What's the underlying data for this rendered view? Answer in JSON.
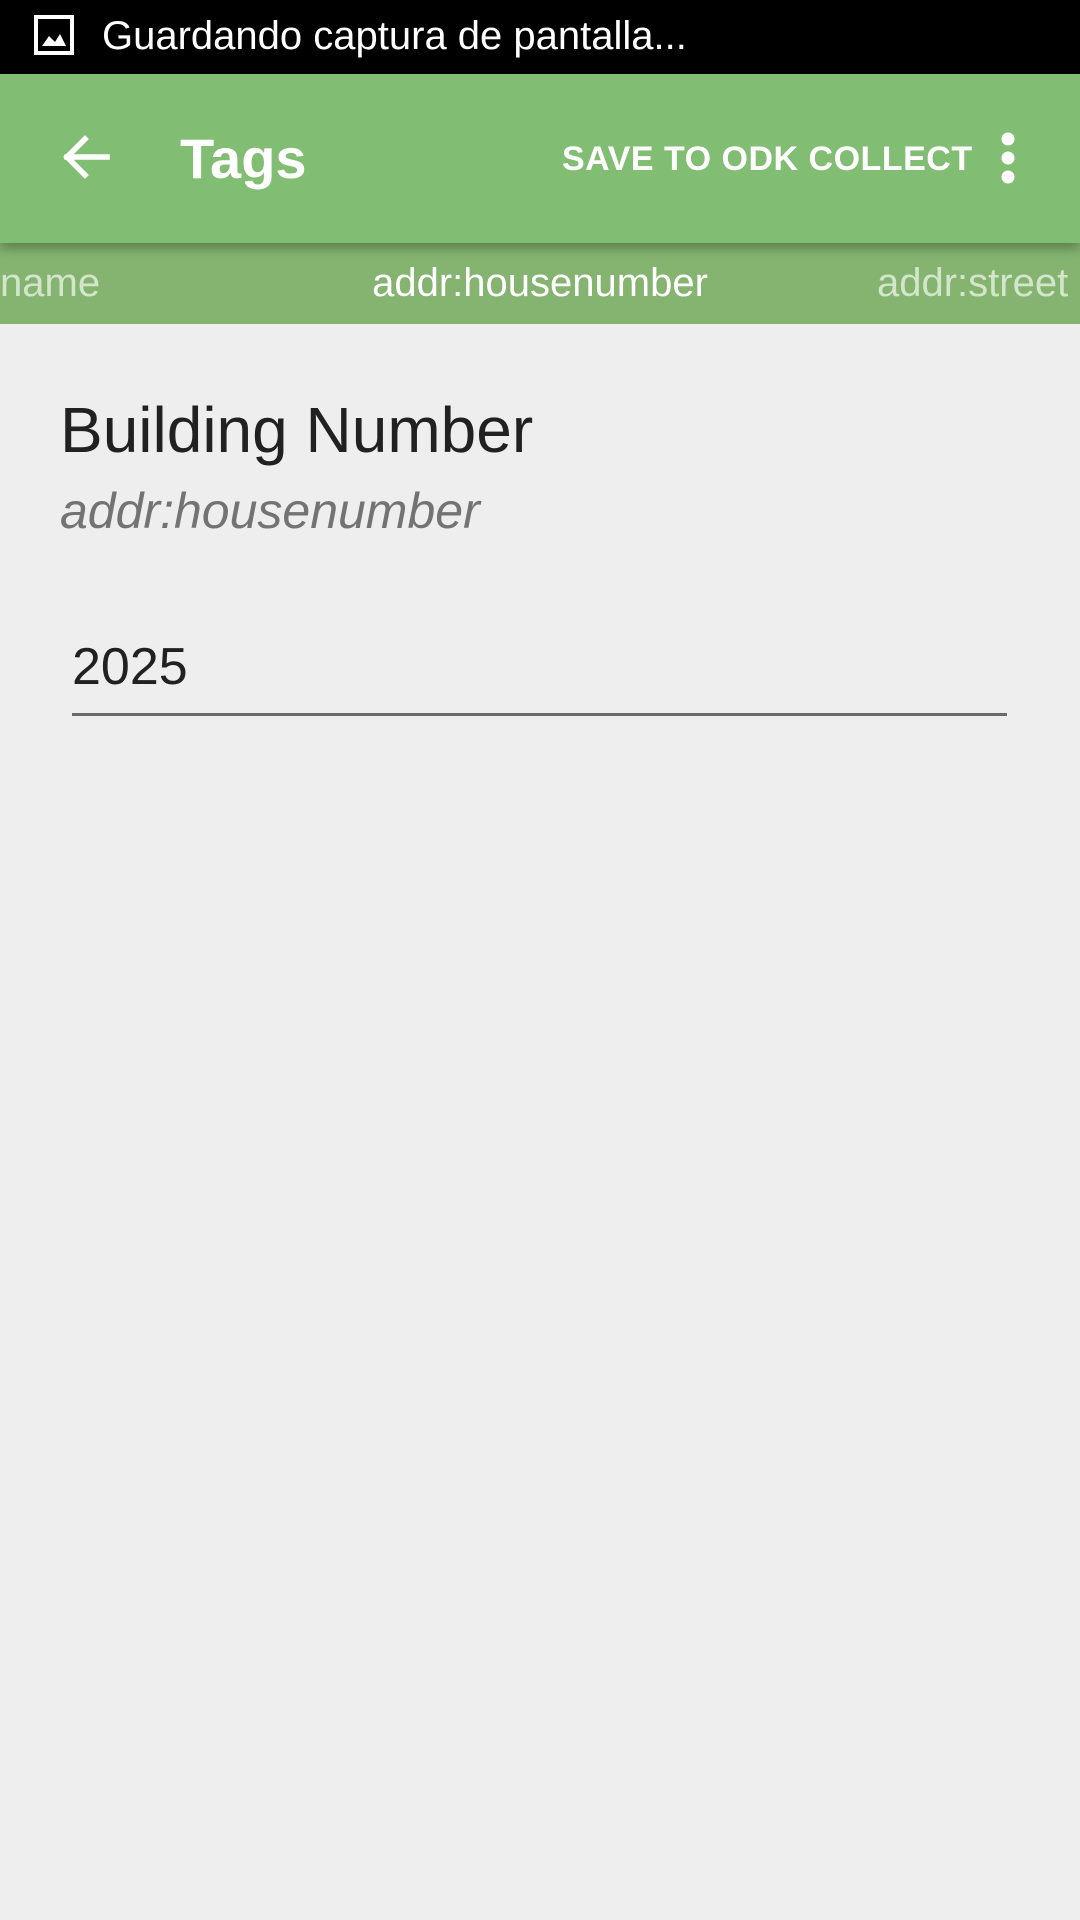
{
  "status_bar": {
    "notification_icon": "image-icon",
    "text": "Guardando captura de pantalla..."
  },
  "app_bar": {
    "back_icon": "arrow-back-icon",
    "title": "Tags",
    "save_label": "SAVE TO ODK COLLECT",
    "overflow_icon": "more-vert-icon"
  },
  "tabs": [
    {
      "label": "name",
      "active": false
    },
    {
      "label": "addr:housenumber",
      "active": true
    },
    {
      "label": "addr:street",
      "active": false
    }
  ],
  "field": {
    "title": "Building Number",
    "key": "addr:housenumber",
    "value": "2025"
  },
  "colors": {
    "status_bar": "#000000",
    "app_bar": "#81bd72",
    "tab_strip": "#85b370",
    "background": "#eeeeee"
  }
}
